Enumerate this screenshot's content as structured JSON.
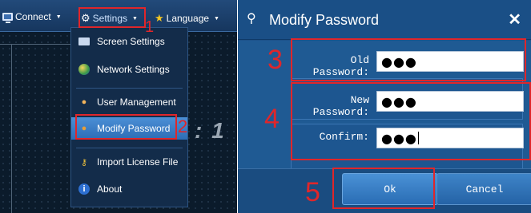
{
  "left_panel": {
    "topbar": {
      "connect_label": "Connect",
      "settings_label": "Settings",
      "language_label": "Language"
    },
    "dropdown": {
      "items": [
        {
          "label": "Screen Settings",
          "icon": "monitor-icon"
        },
        {
          "label": "Network Settings",
          "icon": "network-globe-icon"
        },
        {
          "label": "User Management",
          "icon": "user-icon"
        },
        {
          "label": "Modify Password",
          "icon": "user-key-icon",
          "selected": true
        },
        {
          "label": "Import License File",
          "icon": "key-icon"
        },
        {
          "label": "About",
          "icon": "info-icon"
        }
      ]
    },
    "background_text": ": 1"
  },
  "dialog": {
    "title": "Modify Password",
    "fields": {
      "old_password": {
        "label": "Old Password:",
        "value": "●●●"
      },
      "new_password": {
        "label": "New Password:",
        "value": "●●●"
      },
      "confirm": {
        "label": "Confirm:",
        "value": "●●●"
      }
    },
    "buttons": {
      "ok": "Ok",
      "cancel": "Cancel"
    }
  },
  "annotations": {
    "step1": "1",
    "step2": "2",
    "step3": "3",
    "step4": "4",
    "step5": "5",
    "highlight_color": "#e0262a"
  },
  "colors": {
    "panel_dark": "#0a1a2c",
    "dialog_blue": "#1f5a93",
    "menu_highlight": "#3c7fc8"
  }
}
